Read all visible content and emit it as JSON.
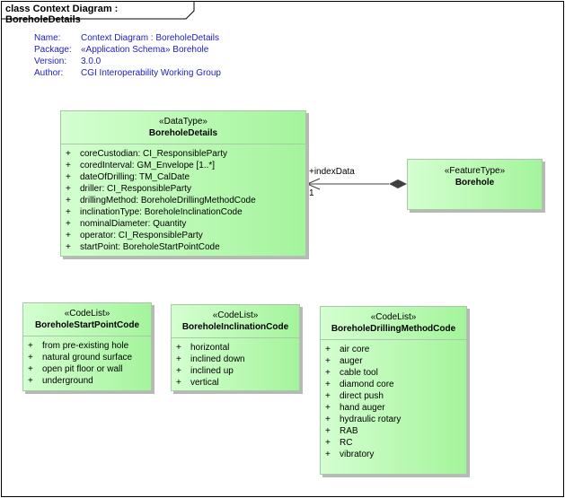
{
  "frame_title": "class Context Diagram : BoreholeDetails",
  "metadata": [
    {
      "key": "Name:",
      "value": "Context Diagram : BoreholeDetails"
    },
    {
      "key": "Package:",
      "value": "«Application Schema» Borehole"
    },
    {
      "key": "Version:",
      "value": "3.0.0"
    },
    {
      "key": "Author:",
      "value": "CGI Interoperability Working Group"
    }
  ],
  "classes": {
    "borehole_details": {
      "stereotype": "«DataType»",
      "name": "BoreholeDetails",
      "attributes": [
        "coreCustodian: CI_ResponsibleParty",
        "coredInterval: GM_Envelope [1..*]",
        "dateOfDrilling: TM_CalDate",
        "driller: CI_ResponsibleParty",
        "drillingMethod: BoreholeDrillingMethodCode",
        "inclinationType: BoreholeInclinationCode",
        "nominalDiameter: Quantity",
        "operator: CI_ResponsibleParty",
        "startPoint: BoreholeStartPointCode"
      ]
    },
    "borehole": {
      "stereotype": "«FeatureType»",
      "name": "Borehole",
      "attributes": []
    },
    "start_point": {
      "stereotype": "«CodeList»",
      "name": "BoreholeStartPointCode",
      "attributes": [
        "from pre-existing hole",
        "natural ground surface",
        "open pit floor or wall",
        "underground"
      ]
    },
    "inclination": {
      "stereotype": "«CodeList»",
      "name": "BoreholeInclinationCode",
      "attributes": [
        "horizontal",
        "inclined down",
        "inclined up",
        "vertical"
      ]
    },
    "drilling_method": {
      "stereotype": "«CodeList»",
      "name": "BoreholeDrillingMethodCode",
      "attributes": [
        "air core",
        "auger",
        "cable tool",
        "diamond core",
        "direct push",
        "hand auger",
        "hydraulic rotary",
        "RAB",
        "RC",
        "vibratory"
      ]
    }
  },
  "association": {
    "role": "+indexData",
    "multiplicity": "1",
    "visibility_marker": "+"
  }
}
